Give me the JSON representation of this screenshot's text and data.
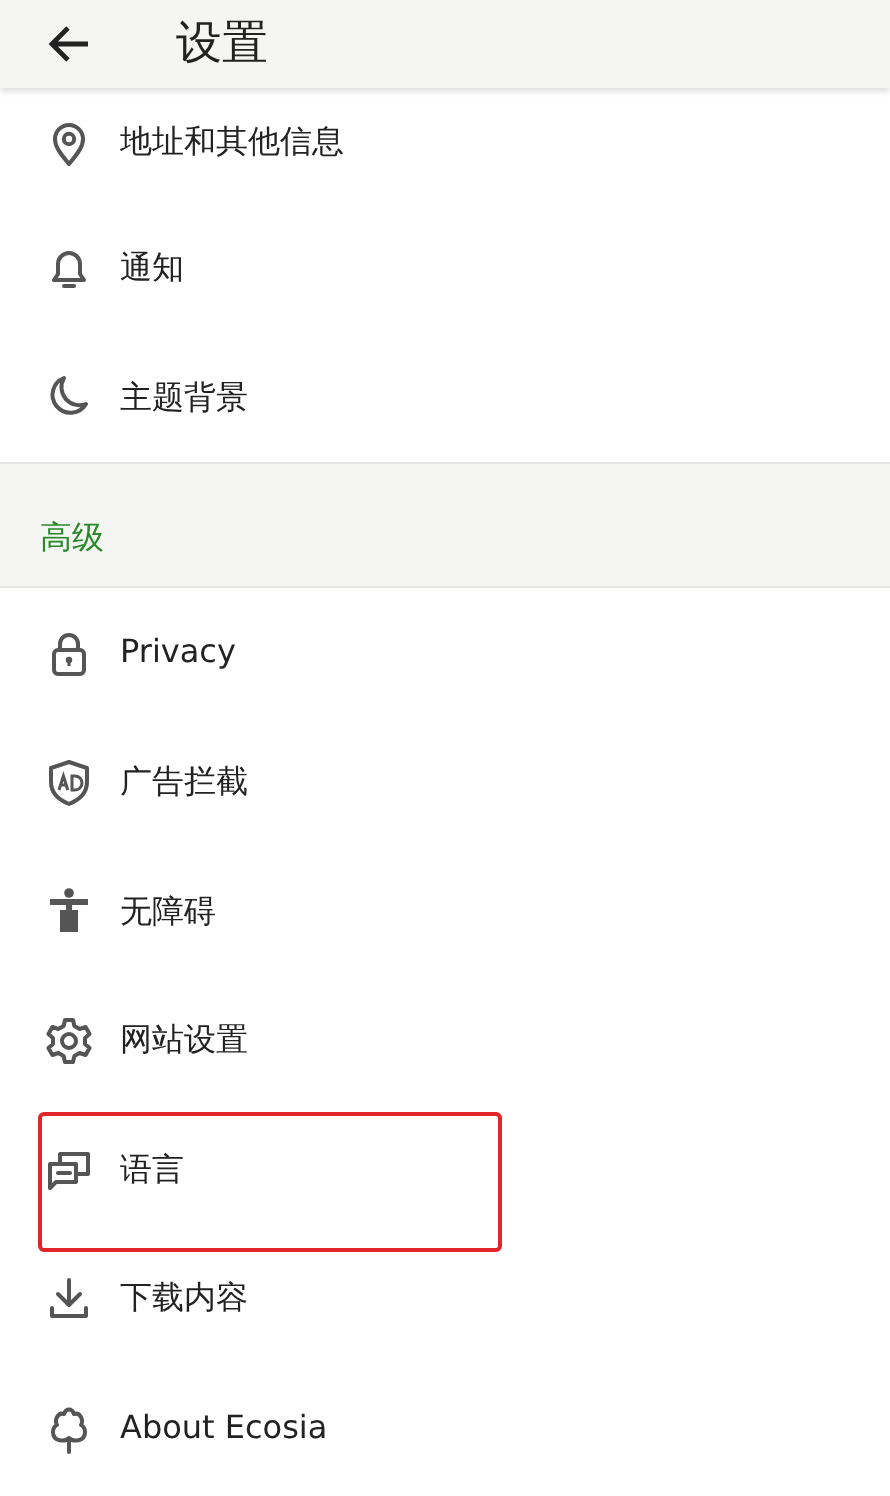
{
  "header": {
    "title": "设置"
  },
  "rows": [
    {
      "kind": "item",
      "label": "地址和其他信息",
      "highlighted": false
    },
    {
      "kind": "item",
      "label": "通知",
      "highlighted": false
    },
    {
      "kind": "item",
      "label": "主题背景",
      "highlighted": false
    },
    {
      "kind": "section",
      "label": "高级"
    },
    {
      "kind": "item",
      "label": "Privacy",
      "highlighted": false
    },
    {
      "kind": "item",
      "label": "广告拦截",
      "highlighted": false
    },
    {
      "kind": "item",
      "label": "无障碍",
      "highlighted": false
    },
    {
      "kind": "item",
      "label": "网站设置",
      "highlighted": false
    },
    {
      "kind": "item",
      "label": "语言",
      "highlighted": true
    },
    {
      "kind": "item",
      "label": "下载内容",
      "highlighted": false
    },
    {
      "kind": "item",
      "label": "About Ecosia",
      "highlighted": false
    }
  ]
}
